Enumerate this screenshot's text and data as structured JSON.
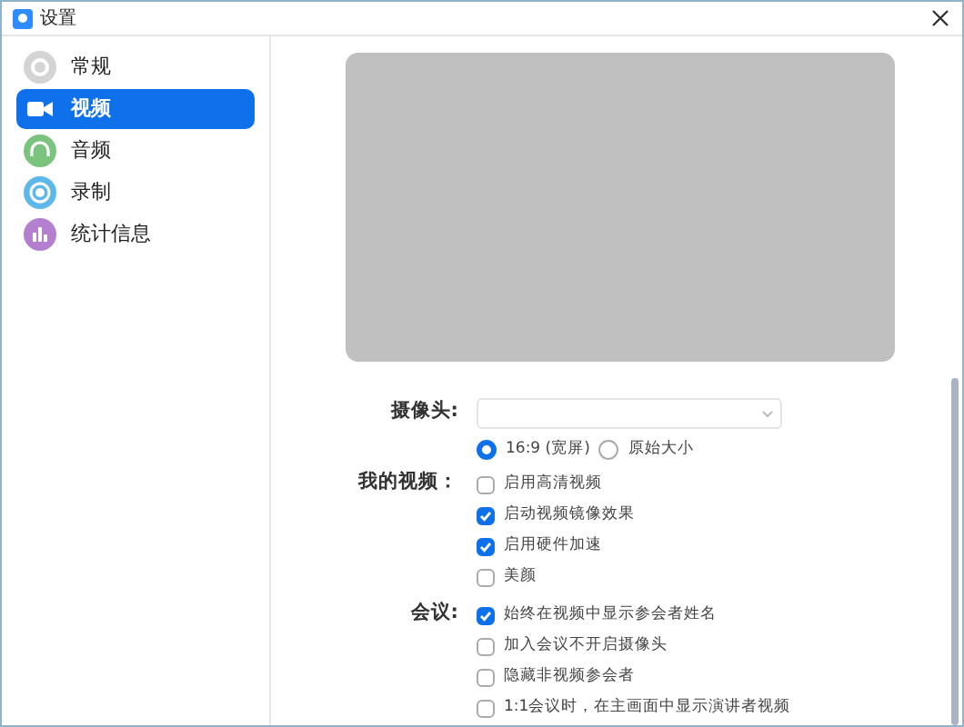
{
  "window": {
    "title": "设置"
  },
  "sidebar": {
    "items": [
      {
        "label": "常规",
        "selected": false
      },
      {
        "label": "视频",
        "selected": true
      },
      {
        "label": "音频",
        "selected": false
      },
      {
        "label": "录制",
        "selected": false
      },
      {
        "label": "统计信息",
        "selected": false
      }
    ]
  },
  "camera": {
    "label": "摄像头:"
  },
  "aspect": [
    {
      "label": "16:9 (宽屏)",
      "selected": true
    },
    {
      "label": "原始大小",
      "selected": false
    }
  ],
  "sections": [
    {
      "label": "我的视频：",
      "options": [
        {
          "label": "启用高清视频",
          "checked": false
        },
        {
          "label": "启动视频镜像效果",
          "checked": true
        },
        {
          "label": "启用硬件加速",
          "checked": true
        },
        {
          "label": "美颜",
          "checked": false
        }
      ]
    },
    {
      "label": "会议:",
      "options": [
        {
          "label": "始终在视频中显示参会者姓名",
          "checked": true
        },
        {
          "label": "加入会议不开启摄像头",
          "checked": false
        },
        {
          "label": "隐藏非视频参会者",
          "checked": false
        },
        {
          "label": "1:1会议时，在主画面中显示演讲者视频",
          "checked": false
        }
      ]
    }
  ]
}
